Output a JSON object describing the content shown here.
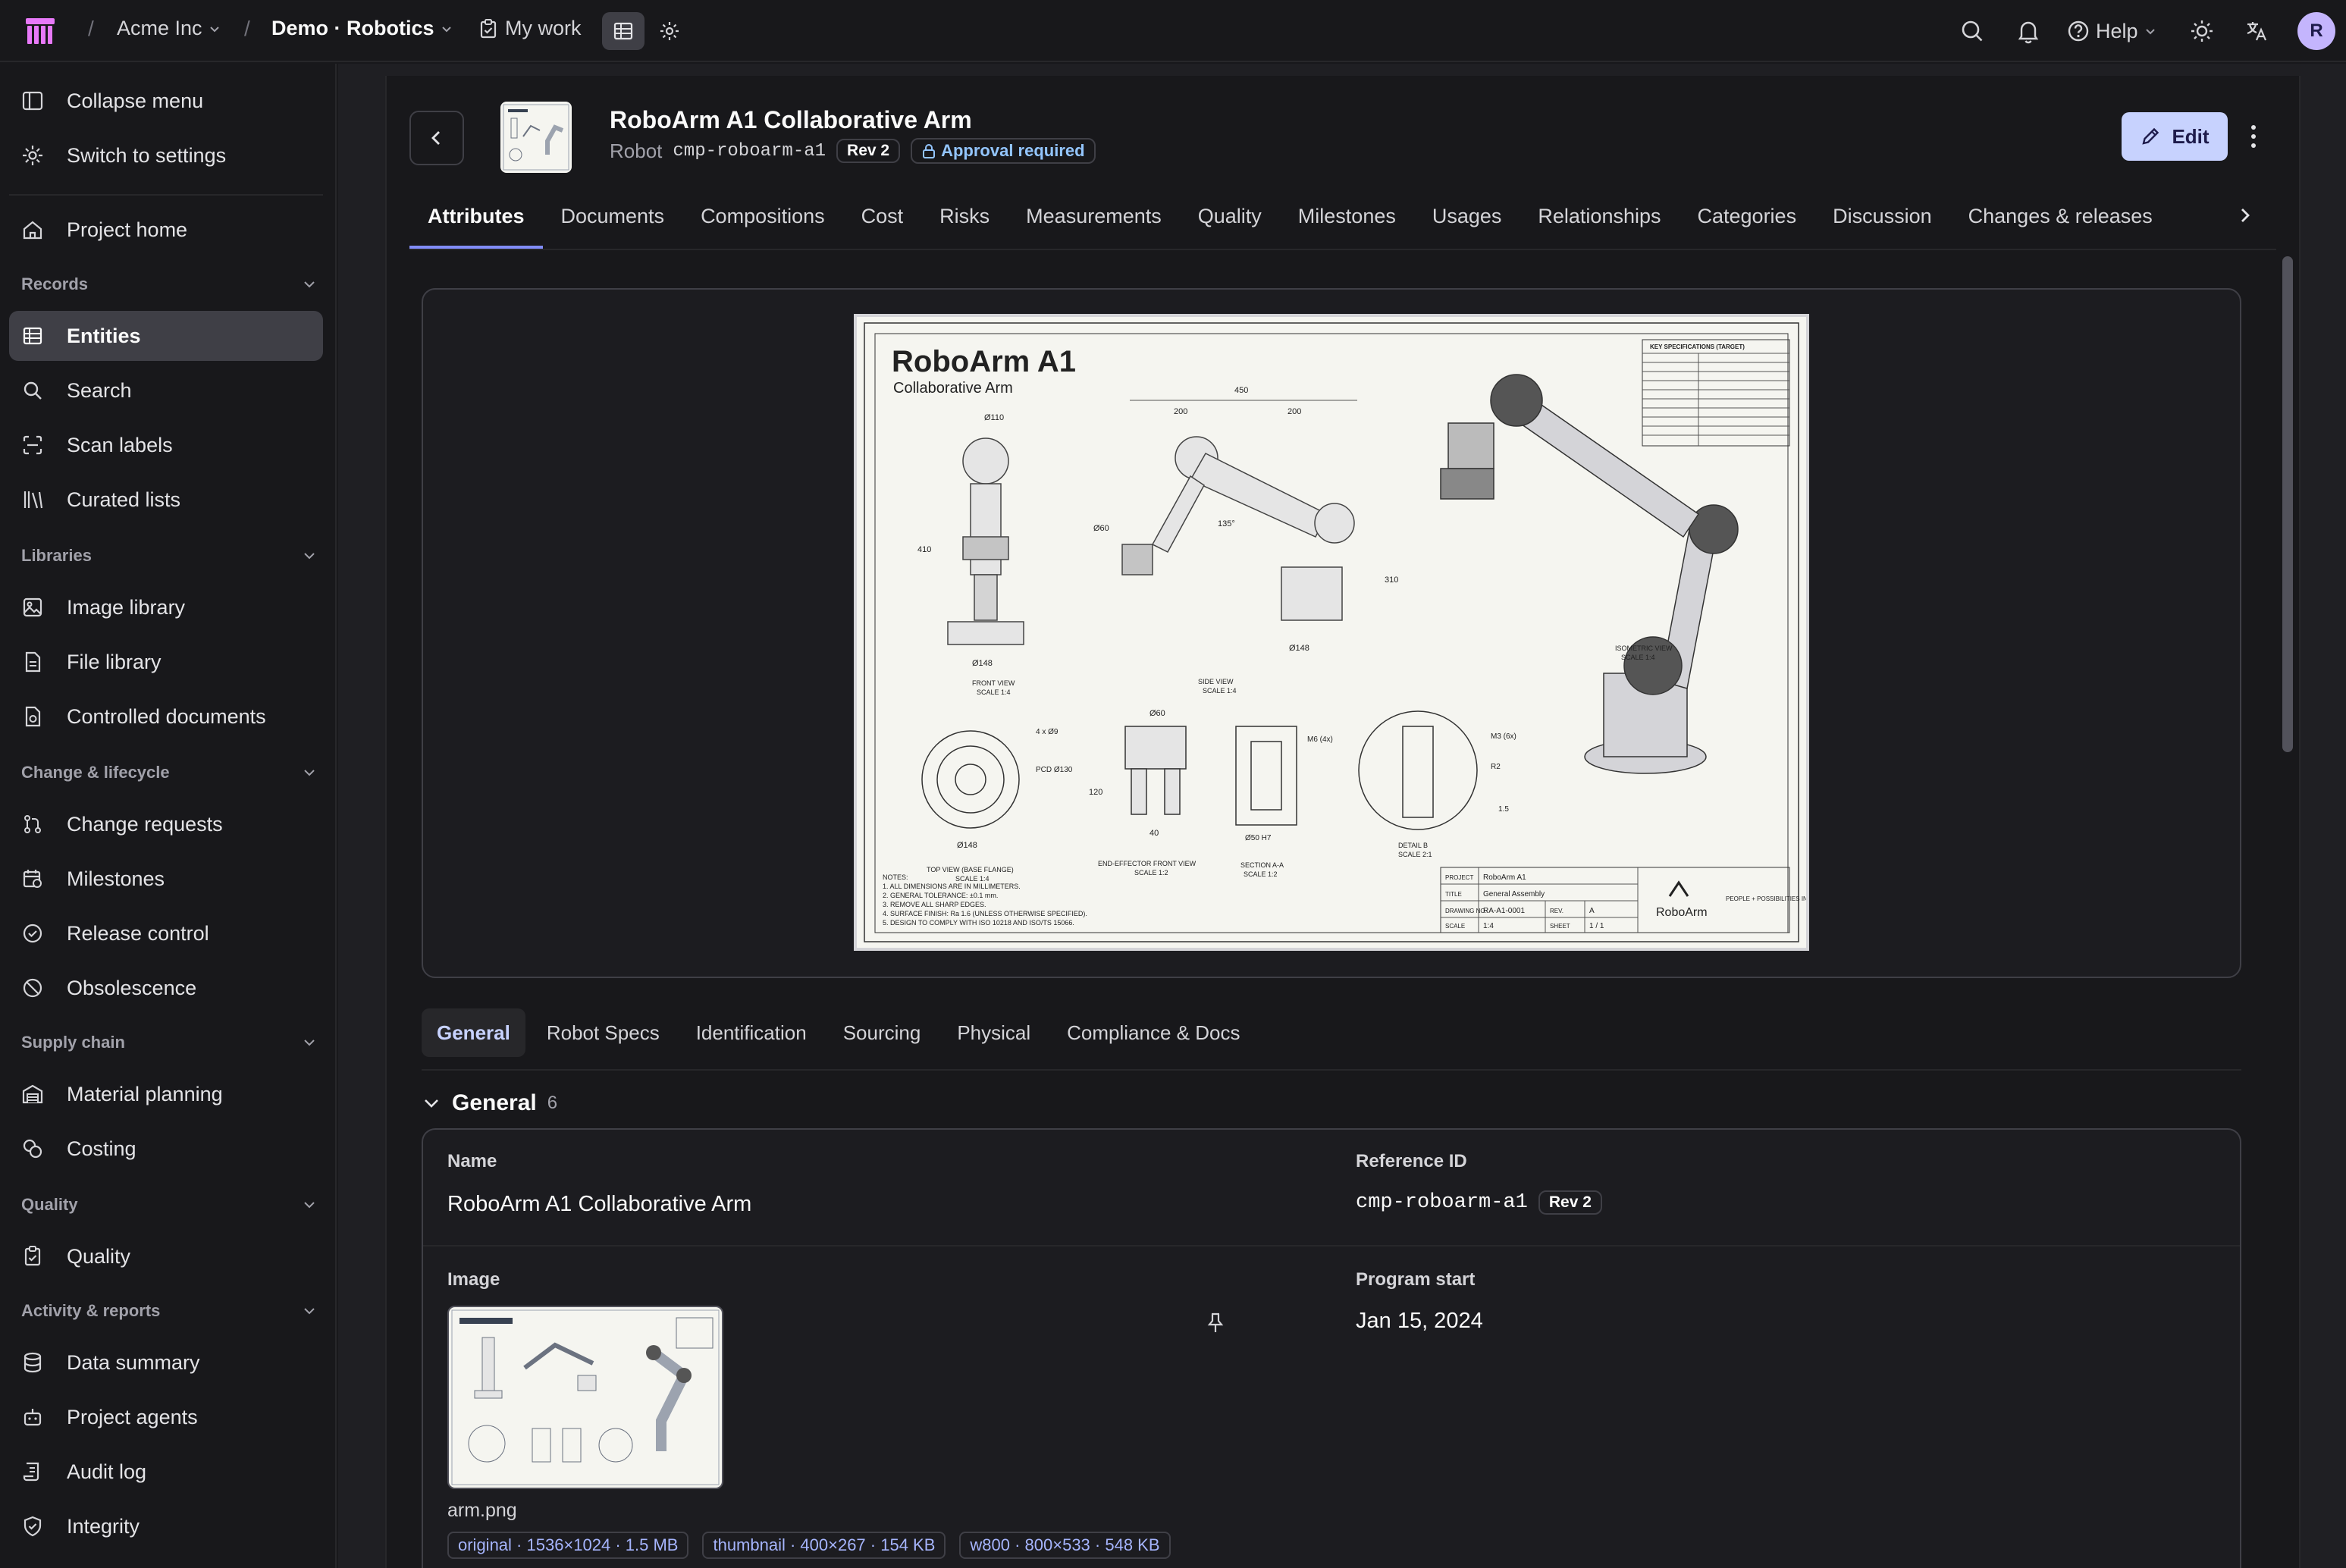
{
  "topbar": {
    "org": "Acme Inc",
    "project": "Demo · Robotics",
    "my_work": "My work",
    "help": "Help",
    "avatar_initial": "R"
  },
  "sidebar": {
    "collapse": "Collapse menu",
    "switch_settings": "Switch to settings",
    "project_home": "Project home",
    "sections": {
      "records": "Records",
      "libraries": "Libraries",
      "change": "Change & lifecycle",
      "supply": "Supply chain",
      "quality": "Quality",
      "activity": "Activity & reports"
    },
    "items": {
      "entities": "Entities",
      "search": "Search",
      "scan_labels": "Scan labels",
      "curated_lists": "Curated lists",
      "image_library": "Image library",
      "file_library": "File library",
      "controlled_documents": "Controlled documents",
      "change_requests": "Change requests",
      "milestones": "Milestones",
      "release_control": "Release control",
      "obsolescence": "Obsolescence",
      "material_planning": "Material planning",
      "costing": "Costing",
      "quality": "Quality",
      "data_summary": "Data summary",
      "project_agents": "Project agents",
      "audit_log": "Audit log",
      "integrity": "Integrity"
    }
  },
  "entity": {
    "title": "RoboArm A1 Collaborative Arm",
    "type": "Robot",
    "code": "cmp-roboarm-a1",
    "rev": "Rev 2",
    "approval": "Approval required",
    "edit": "Edit"
  },
  "tabs": [
    "Attributes",
    "Documents",
    "Compositions",
    "Cost",
    "Risks",
    "Measurements",
    "Quality",
    "Milestones",
    "Usages",
    "Relationships",
    "Categories",
    "Discussion",
    "Changes & releases"
  ],
  "drawing": {
    "title": "RoboArm A1",
    "subtitle": "Collaborative Arm",
    "brand": "RoboArm",
    "tagline": "PEOPLE + POSSIBILITIES IN MOTION",
    "specs_title": "KEY SPECIFICATIONS (TARGET)",
    "dims": [
      "450",
      "200",
      "200",
      "Ø110",
      "410",
      "Ø60",
      "135°",
      "310",
      "Ø148",
      "Ø148",
      "4 x Ø9",
      "PCD Ø130",
      "Ø148",
      "Ø60",
      "120",
      "40",
      "Ø50 H7",
      "M6 (4x)",
      "M3 (6x)",
      "R2",
      "1.5"
    ],
    "views": [
      "FRONT VIEW",
      "SCALE 1:4",
      "SIDE VIEW",
      "SCALE 1:4",
      "ISOMETRIC VIEW",
      "SCALE 1:4",
      "TOP VIEW (BASE FLANGE)",
      "SCALE 1:4",
      "END-EFFECTOR FRONT VIEW",
      "SCALE 1:2",
      "SECTION A-A",
      "SCALE 1:2",
      "DETAIL B",
      "SCALE 2:1"
    ],
    "block": {
      "project_label": "PROJECT",
      "project": "RoboArm A1",
      "title_label": "TITLE",
      "title": "General Assembly",
      "drawing_label": "DRAWING NO.",
      "drawing_no": "RA-A1-0001",
      "rev_label": "REV.",
      "rev": "A",
      "scale_label": "SCALE",
      "scale": "1:4",
      "sheet_label": "SHEET",
      "sheet": "1 / 1"
    },
    "notes": [
      "NOTES:",
      "1. ALL DIMENSIONS ARE IN MILLIMETERS.",
      "2. GENERAL TOLERANCE: ±0.1 mm.",
      "3. REMOVE ALL SHARP EDGES.",
      "4. SURFACE FINISH: Ra 1.6 (UNLESS OTHERWISE SPECIFIED).",
      "5. DESIGN TO COMPLY WITH ISO 10218 AND ISO/TS 15066."
    ]
  },
  "subtabs": [
    "General",
    "Robot Specs",
    "Identification",
    "Sourcing",
    "Physical",
    "Compliance & Docs"
  ],
  "general": {
    "title": "General",
    "count": "6",
    "name_label": "Name",
    "name_value": "RoboArm A1 Collaborative Arm",
    "ref_label": "Reference ID",
    "ref_value": "cmp-roboarm-a1",
    "ref_rev": "Rev 2",
    "image_label": "Image",
    "file_name": "arm.png",
    "variants": [
      "original · 1536×1024 · 1.5 MB",
      "thumbnail · 400×267 · 154 KB",
      "w800 · 800×533 · 548 KB"
    ],
    "program_label": "Program start",
    "program_value": "Jan 15, 2024"
  },
  "colors": {
    "accent": "#818cf8",
    "edit_bg": "#c7d2fe",
    "approval": "#93c5fd",
    "bg": "#18181b"
  }
}
